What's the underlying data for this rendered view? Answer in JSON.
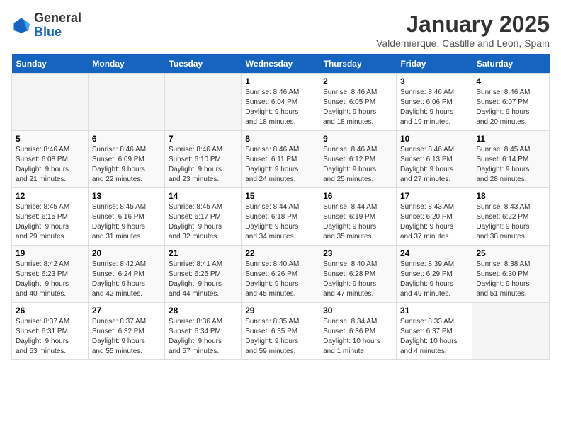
{
  "logo": {
    "general": "General",
    "blue": "Blue"
  },
  "header": {
    "title": "January 2025",
    "subtitle": "Valdemierque, Castille and Leon, Spain"
  },
  "weekdays": [
    "Sunday",
    "Monday",
    "Tuesday",
    "Wednesday",
    "Thursday",
    "Friday",
    "Saturday"
  ],
  "weeks": [
    [
      {
        "day": "",
        "info": ""
      },
      {
        "day": "",
        "info": ""
      },
      {
        "day": "",
        "info": ""
      },
      {
        "day": "1",
        "info": "Sunrise: 8:46 AM\nSunset: 6:04 PM\nDaylight: 9 hours\nand 18 minutes."
      },
      {
        "day": "2",
        "info": "Sunrise: 8:46 AM\nSunset: 6:05 PM\nDaylight: 9 hours\nand 18 minutes."
      },
      {
        "day": "3",
        "info": "Sunrise: 8:46 AM\nSunset: 6:06 PM\nDaylight: 9 hours\nand 19 minutes."
      },
      {
        "day": "4",
        "info": "Sunrise: 8:46 AM\nSunset: 6:07 PM\nDaylight: 9 hours\nand 20 minutes."
      }
    ],
    [
      {
        "day": "5",
        "info": "Sunrise: 8:46 AM\nSunset: 6:08 PM\nDaylight: 9 hours\nand 21 minutes."
      },
      {
        "day": "6",
        "info": "Sunrise: 8:46 AM\nSunset: 6:09 PM\nDaylight: 9 hours\nand 22 minutes."
      },
      {
        "day": "7",
        "info": "Sunrise: 8:46 AM\nSunset: 6:10 PM\nDaylight: 9 hours\nand 23 minutes."
      },
      {
        "day": "8",
        "info": "Sunrise: 8:46 AM\nSunset: 6:11 PM\nDaylight: 9 hours\nand 24 minutes."
      },
      {
        "day": "9",
        "info": "Sunrise: 8:46 AM\nSunset: 6:12 PM\nDaylight: 9 hours\nand 25 minutes."
      },
      {
        "day": "10",
        "info": "Sunrise: 8:46 AM\nSunset: 6:13 PM\nDaylight: 9 hours\nand 27 minutes."
      },
      {
        "day": "11",
        "info": "Sunrise: 8:45 AM\nSunset: 6:14 PM\nDaylight: 9 hours\nand 28 minutes."
      }
    ],
    [
      {
        "day": "12",
        "info": "Sunrise: 8:45 AM\nSunset: 6:15 PM\nDaylight: 9 hours\nand 29 minutes."
      },
      {
        "day": "13",
        "info": "Sunrise: 8:45 AM\nSunset: 6:16 PM\nDaylight: 9 hours\nand 31 minutes."
      },
      {
        "day": "14",
        "info": "Sunrise: 8:45 AM\nSunset: 6:17 PM\nDaylight: 9 hours\nand 32 minutes."
      },
      {
        "day": "15",
        "info": "Sunrise: 8:44 AM\nSunset: 6:18 PM\nDaylight: 9 hours\nand 34 minutes."
      },
      {
        "day": "16",
        "info": "Sunrise: 8:44 AM\nSunset: 6:19 PM\nDaylight: 9 hours\nand 35 minutes."
      },
      {
        "day": "17",
        "info": "Sunrise: 8:43 AM\nSunset: 6:20 PM\nDaylight: 9 hours\nand 37 minutes."
      },
      {
        "day": "18",
        "info": "Sunrise: 8:43 AM\nSunset: 6:22 PM\nDaylight: 9 hours\nand 38 minutes."
      }
    ],
    [
      {
        "day": "19",
        "info": "Sunrise: 8:42 AM\nSunset: 6:23 PM\nDaylight: 9 hours\nand 40 minutes."
      },
      {
        "day": "20",
        "info": "Sunrise: 8:42 AM\nSunset: 6:24 PM\nDaylight: 9 hours\nand 42 minutes."
      },
      {
        "day": "21",
        "info": "Sunrise: 8:41 AM\nSunset: 6:25 PM\nDaylight: 9 hours\nand 44 minutes."
      },
      {
        "day": "22",
        "info": "Sunrise: 8:40 AM\nSunset: 6:26 PM\nDaylight: 9 hours\nand 45 minutes."
      },
      {
        "day": "23",
        "info": "Sunrise: 8:40 AM\nSunset: 6:28 PM\nDaylight: 9 hours\nand 47 minutes."
      },
      {
        "day": "24",
        "info": "Sunrise: 8:39 AM\nSunset: 6:29 PM\nDaylight: 9 hours\nand 49 minutes."
      },
      {
        "day": "25",
        "info": "Sunrise: 8:38 AM\nSunset: 6:30 PM\nDaylight: 9 hours\nand 51 minutes."
      }
    ],
    [
      {
        "day": "26",
        "info": "Sunrise: 8:37 AM\nSunset: 6:31 PM\nDaylight: 9 hours\nand 53 minutes."
      },
      {
        "day": "27",
        "info": "Sunrise: 8:37 AM\nSunset: 6:32 PM\nDaylight: 9 hours\nand 55 minutes."
      },
      {
        "day": "28",
        "info": "Sunrise: 8:36 AM\nSunset: 6:34 PM\nDaylight: 9 hours\nand 57 minutes."
      },
      {
        "day": "29",
        "info": "Sunrise: 8:35 AM\nSunset: 6:35 PM\nDaylight: 9 hours\nand 59 minutes."
      },
      {
        "day": "30",
        "info": "Sunrise: 8:34 AM\nSunset: 6:36 PM\nDaylight: 10 hours\nand 1 minute."
      },
      {
        "day": "31",
        "info": "Sunrise: 8:33 AM\nSunset: 6:37 PM\nDaylight: 10 hours\nand 4 minutes."
      },
      {
        "day": "",
        "info": ""
      }
    ]
  ]
}
